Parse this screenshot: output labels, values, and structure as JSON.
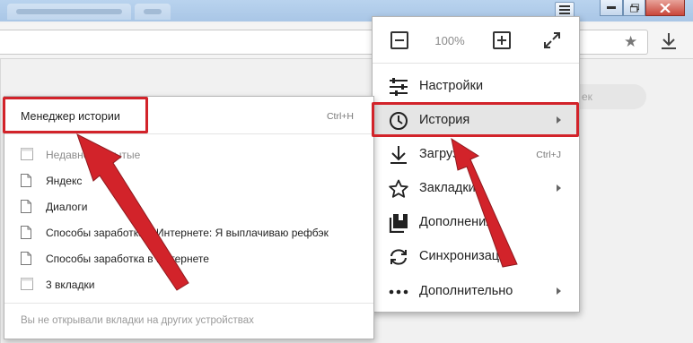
{
  "toolbar": {
    "zoom_value": "100%"
  },
  "menu": {
    "items": [
      {
        "label": "Настройки",
        "shortcut": "",
        "arrow": false,
        "icon": "settings-sliders-icon"
      },
      {
        "label": "История",
        "shortcut": "",
        "arrow": true,
        "icon": "clock-icon"
      },
      {
        "label": "Загрузки",
        "shortcut": "Ctrl+J",
        "arrow": false,
        "icon": "download-icon"
      },
      {
        "label": "Закладки",
        "shortcut": "",
        "arrow": true,
        "icon": "star-icon"
      },
      {
        "label": "Дополнения",
        "shortcut": "",
        "arrow": false,
        "icon": "extensions-icon"
      },
      {
        "label": "Синхронизация",
        "shortcut": "",
        "arrow": false,
        "icon": "sync-icon"
      },
      {
        "label": "Дополнительно",
        "shortcut": "",
        "arrow": true,
        "icon": "more-dots-icon"
      }
    ]
  },
  "history": {
    "manager_label": "Менеджер истории",
    "manager_shortcut": "Ctrl+H",
    "items": [
      {
        "label": "Недавно закрытые",
        "icon": "folder-icon",
        "muted": true
      },
      {
        "label": "Яндекс",
        "icon": "page-icon",
        "muted": false
      },
      {
        "label": "Диалоги",
        "icon": "page-icon",
        "muted": false
      },
      {
        "label": "Способы заработка в Интернете: Я выплачиваю рефбэк",
        "icon": "page-icon",
        "muted": false
      },
      {
        "label": "Способы заработка в Интернете",
        "icon": "page-icon",
        "muted": false
      },
      {
        "label": "3 вкладки",
        "icon": "folder-icon",
        "muted": false
      }
    ],
    "footer": "Вы не открывали вкладки на других устройствах"
  },
  "page": {
    "search_placeholder": "ек"
  },
  "colors": {
    "annotation": "#d2232a",
    "hover": "#e5e5e5"
  }
}
